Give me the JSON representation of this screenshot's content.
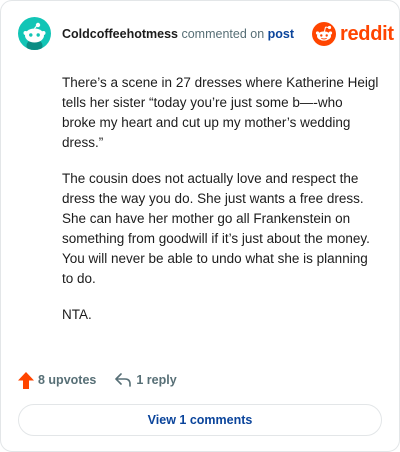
{
  "comment": {
    "username": "Coldcoffeehotmess",
    "action_text": "commented on",
    "post_link": "post",
    "paragraphs": [
      "There’s a scene in 27 dresses where Katherine Heigl tells her sister “today you’re just some b—-who broke my heart and cut up my mother’s wedding dress.”",
      "The cousin does not actually love and respect the dress the way you do. She just wants a free dress. She can have her mother go all Frankenstein on something from goodwill if it’s just about the money. You will never be able to undo what she is planning to do.",
      "NTA."
    ]
  },
  "brand": {
    "name": "reddit",
    "color": "#ff4500"
  },
  "footer": {
    "upvotes": "8 upvotes",
    "replies": "1 reply",
    "view_comments": "View 1 comments"
  },
  "icons": {
    "avatar": "snoo-avatar-icon",
    "logo": "reddit-logo-icon",
    "upvote": "upvote-arrow-icon",
    "reply": "reply-arrow-icon"
  },
  "colors": {
    "avatar_bg": "#12c5b6",
    "link": "#0a449b",
    "upvote": "#ff4500"
  }
}
